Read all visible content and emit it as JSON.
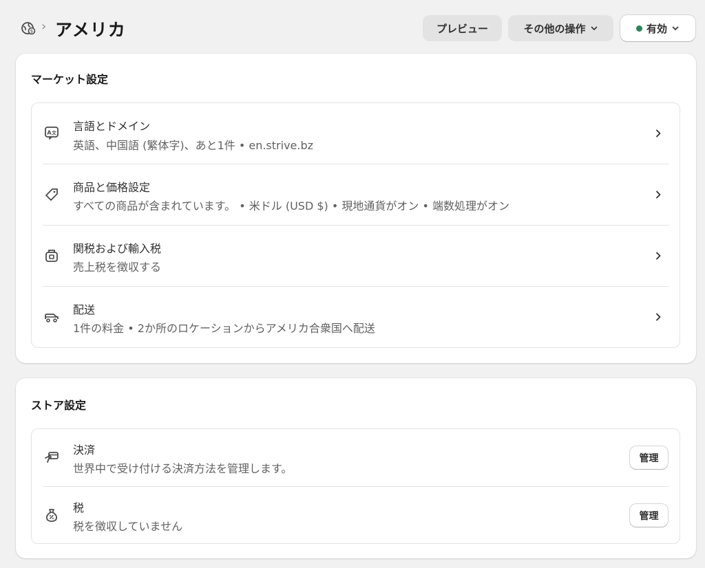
{
  "header": {
    "title": "アメリカ",
    "separator": "›",
    "preview_label": "プレビュー",
    "more_actions_label": "その他の操作",
    "status_label": "有効",
    "status_color": "#29845a"
  },
  "market_settings": {
    "title": "マーケット設定",
    "items": [
      {
        "icon": "language-icon",
        "title": "言語とドメイン",
        "subtitle": "英語、中国語 (繁体字)、あと1件 • en.strive.bz"
      },
      {
        "icon": "tag-icon",
        "title": "商品と価格設定",
        "subtitle": "すべての商品が含まれています。 • 米ドル (USD $) • 現地通貨がオン • 端数処理がオン"
      },
      {
        "icon": "duties-icon",
        "title": "関税および輸入税",
        "subtitle": "売上税を徴収する"
      },
      {
        "icon": "delivery-truck-icon",
        "title": "配送",
        "subtitle": "1件の料金 • 2か所のロケーションからアメリカ合衆国へ配送"
      }
    ]
  },
  "store_settings": {
    "title": "ストア設定",
    "items": [
      {
        "icon": "payment-hand-icon",
        "title": "決済",
        "subtitle": "世界中で受け付ける決済方法を管理します。",
        "button": "管理"
      },
      {
        "icon": "tax-bag-icon",
        "title": "税",
        "subtitle": "税を徴収していません",
        "button": "管理"
      }
    ]
  }
}
